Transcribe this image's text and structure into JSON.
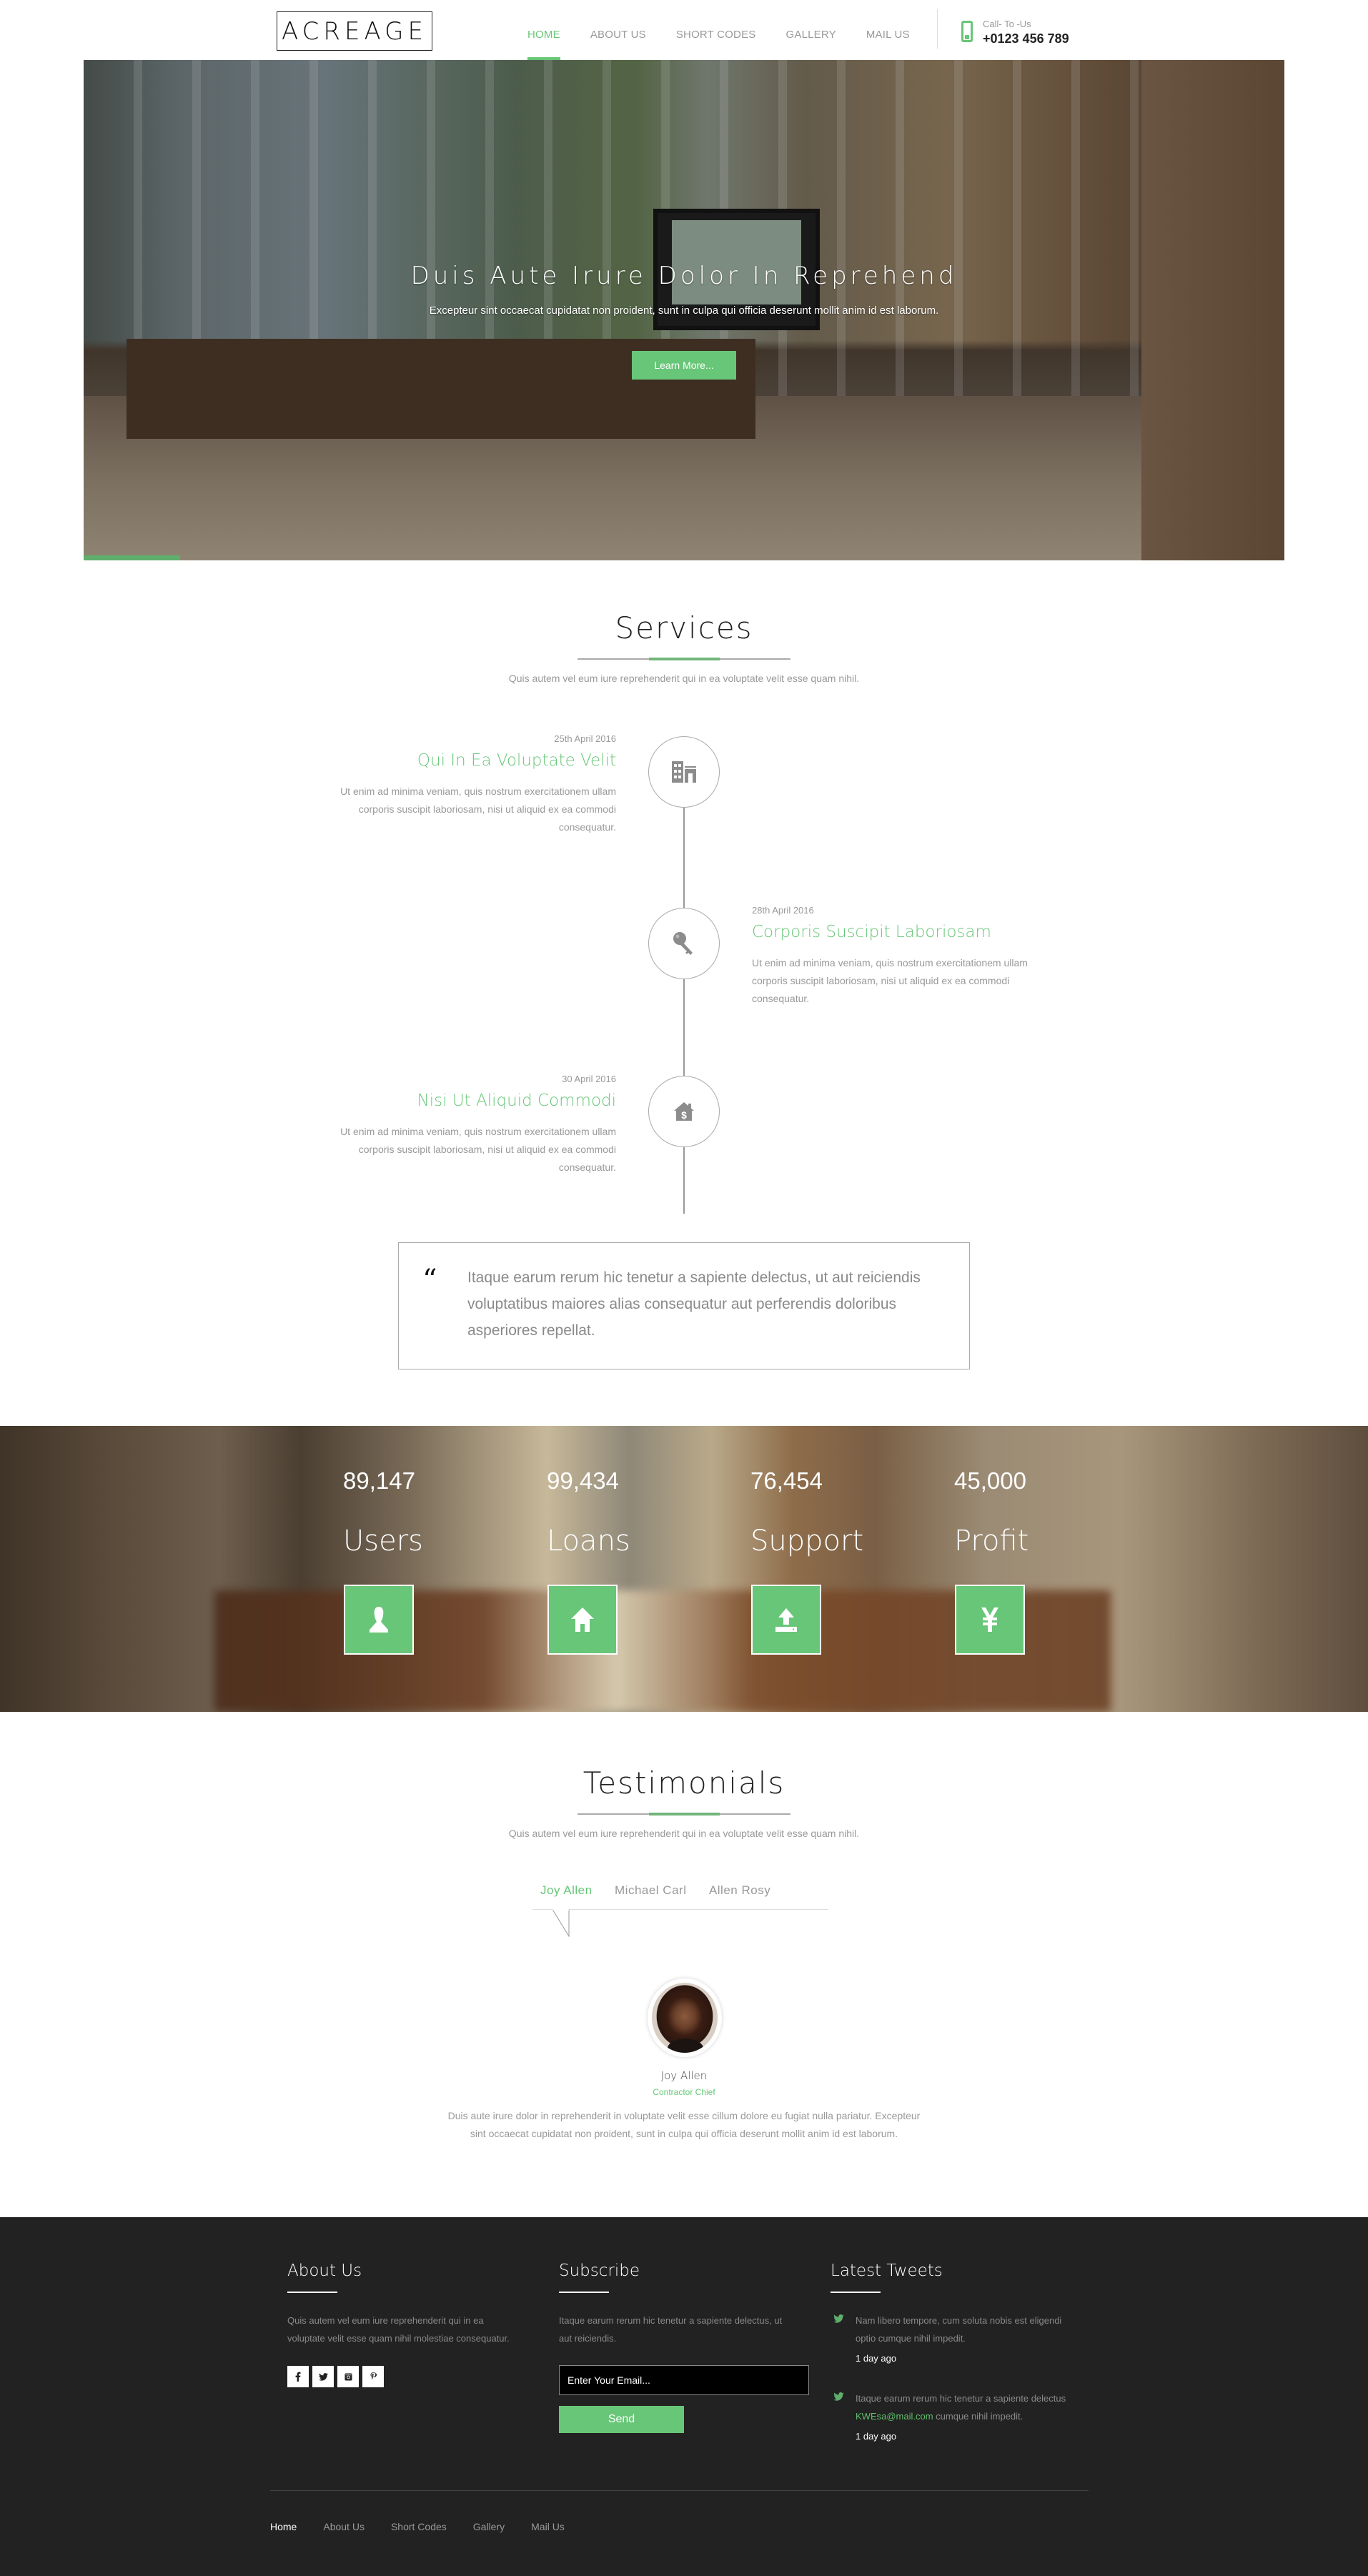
{
  "header": {
    "logo": "ACREAGE",
    "nav": [
      {
        "label": "HOME",
        "active": true
      },
      {
        "label": "ABOUT US",
        "active": false
      },
      {
        "label": "SHORT CODES",
        "active": false
      },
      {
        "label": "GALLERY",
        "active": false
      },
      {
        "label": "MAIL US",
        "active": false
      }
    ],
    "call_label": "Call- To -Us",
    "call_number": "+0123 456 789",
    "phone_icon": "mobile-phone-icon"
  },
  "hero": {
    "title": "Duis Aute Irure Dolor In Reprehend",
    "subtitle": "Excepteur sint occaecat cupidatat non proident, sunt in culpa qui officia deserunt mollit anim id est laborum.",
    "button_label": "Learn More..."
  },
  "services": {
    "title": "Services",
    "subtitle": "Quis autem vel eum iure reprehenderit qui in ea voluptate velit esse quam nihil.",
    "items": [
      {
        "date": "25th April 2016",
        "heading": "Qui In Ea Voluptate Velit",
        "text": "Ut enim ad minima veniam, quis nostrum exercitationem ullam corporis suscipit laboriosam, nisi ut aliquid ex ea commodi consequatur.",
        "icon": "building-icon",
        "side": "left"
      },
      {
        "date": "28th April 2016",
        "heading": "Corporis Suscipit Laboriosam",
        "text": "Ut enim ad minima veniam, quis nostrum exercitationem ullam corporis suscipit laboriosam, nisi ut aliquid ex ea commodi consequatur.",
        "icon": "key-icon",
        "side": "right"
      },
      {
        "date": "30 April 2016",
        "heading": "Nisi Ut Aliquid Commodi",
        "text": "Ut enim ad minima veniam, quis nostrum exercitationem ullam corporis suscipit laboriosam, nisi ut aliquid ex ea commodi consequatur.",
        "icon": "house-dollar-icon",
        "side": "left"
      }
    ],
    "quote_icon": "quote-icon",
    "quote": "Itaque earum rerum hic tenetur a sapiente delectus, ut aut reiciendis voluptatibus maiores alias consequatur aut perferendis doloribus asperiores repellat."
  },
  "stats": [
    {
      "value": "89,147",
      "label": "Users",
      "icon": "user-icon"
    },
    {
      "value": "99,434",
      "label": "Loans",
      "icon": "home-icon"
    },
    {
      "value": "76,454",
      "label": "Support",
      "icon": "upload-icon"
    },
    {
      "value": "45,000",
      "label": "Profit",
      "icon": "yen-icon"
    }
  ],
  "testimonials": {
    "title": "Testimonials",
    "subtitle": "Quis autem vel eum iure reprehenderit qui in ea voluptate velit esse quam nihil.",
    "tabs": [
      {
        "label": "Joy Allen",
        "active": true
      },
      {
        "label": "Michael Carl",
        "active": false
      },
      {
        "label": "Allen Rosy",
        "active": false
      }
    ],
    "current": {
      "name": "Joy Allen",
      "role": "Contractor Chief",
      "text": "Duis aute irure dolor in reprehenderit in voluptate velit esse cillum dolore eu fugiat nulla pariatur. Excepteur sint occaecat cupidatat non proident, sunt in culpa qui officia deserunt mollit anim id est laborum."
    }
  },
  "footer": {
    "about": {
      "title": "About Us",
      "text": "Quis autem vel eum iure reprehenderit qui in ea voluptate velit esse quam nihil molestiae consequatur.",
      "social": [
        {
          "name": "facebook-icon",
          "glyph": "f"
        },
        {
          "name": "twitter-icon",
          "glyph": "t"
        },
        {
          "name": "instagram-icon",
          "glyph": "◘"
        },
        {
          "name": "pinterest-icon",
          "glyph": "p"
        }
      ]
    },
    "subscribe": {
      "title": "Subscribe",
      "text": "Itaque earum rerum hic tenetur a sapiente delectus, ut aut reiciendis.",
      "email_placeholder": "Enter Your Email...",
      "send_label": "Send"
    },
    "tweets": {
      "title": "Latest Tweets",
      "items": [
        {
          "text": "Nam libero tempore, cum soluta nobis est eligendi optio cumque nihil impedit.",
          "time": "1 day ago"
        },
        {
          "text_before": "Itaque earum rerum hic tenetur a sapiente delectus ",
          "email": "KWEsa@mail.com",
          "text_after": " cumque nihil impedit.",
          "time": "1 day ago"
        }
      ]
    },
    "nav": [
      {
        "label": "Home",
        "active": true
      },
      {
        "label": "About Us",
        "active": false
      },
      {
        "label": "Short Codes",
        "active": false
      },
      {
        "label": "Gallery",
        "active": false
      },
      {
        "label": "Mail Us",
        "active": false
      }
    ]
  },
  "colors": {
    "accent": "#68c678",
    "footer_bg": "#222222",
    "muted_text": "#999999"
  }
}
